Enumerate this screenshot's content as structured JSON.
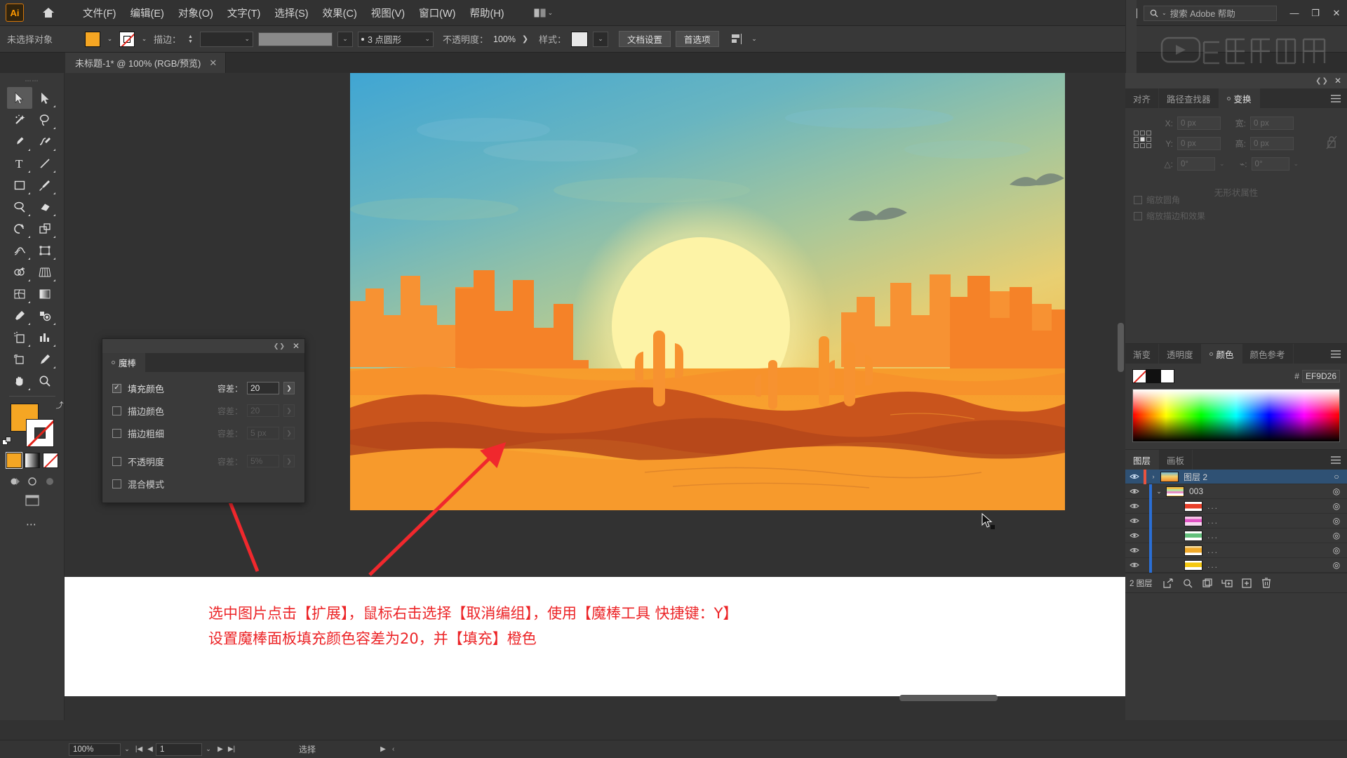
{
  "app": {
    "logo": "Ai",
    "home_icon": "home-icon"
  },
  "menubar": {
    "items": [
      {
        "label": "文件(F)"
      },
      {
        "label": "编辑(E)"
      },
      {
        "label": "对象(O)"
      },
      {
        "label": "文字(T)"
      },
      {
        "label": "选择(S)"
      },
      {
        "label": "效果(C)"
      },
      {
        "label": "视图(V)"
      },
      {
        "label": "窗口(W)"
      },
      {
        "label": "帮助(H)"
      }
    ],
    "arrange_label": "",
    "search_placeholder": "搜索 Adobe 帮助",
    "minimize": "—",
    "maximize": "❐",
    "close": "✕"
  },
  "optionsbar": {
    "no_selection_label": "未选择对象",
    "fill_color": "#F5A623",
    "stroke_label": "描边：",
    "stroke_weight_value": "",
    "profile_value": "",
    "brush_value": "3 点圆形",
    "opacity_label": "不透明度：",
    "opacity_value": "100%",
    "style_label": "样式：",
    "doc_setup_button": "文档设置",
    "preferences_button": "首选项",
    "align_icon": "align-icon"
  },
  "document_tab": {
    "title": "未标题-1* @ 100% (RGB/预览)",
    "close": "✕"
  },
  "toolbar": {
    "tools": [
      {
        "name": "selection-tool",
        "selected": true
      },
      {
        "name": "direct-selection-tool",
        "selected": false
      },
      {
        "name": "magic-wand-tool",
        "selected": false
      },
      {
        "name": "lasso-tool",
        "selected": false
      },
      {
        "name": "pen-tool",
        "selected": false
      },
      {
        "name": "curvature-tool",
        "selected": false
      },
      {
        "name": "type-tool",
        "selected": false
      },
      {
        "name": "line-segment-tool",
        "selected": false
      },
      {
        "name": "rectangle-tool",
        "selected": false
      },
      {
        "name": "paintbrush-tool",
        "selected": false
      },
      {
        "name": "shaper-tool",
        "selected": false
      },
      {
        "name": "eraser-tool",
        "selected": false
      },
      {
        "name": "rotate-tool",
        "selected": false
      },
      {
        "name": "scale-tool",
        "selected": false
      },
      {
        "name": "width-tool",
        "selected": false
      },
      {
        "name": "free-transform-tool",
        "selected": false
      },
      {
        "name": "shape-builder-tool",
        "selected": false
      },
      {
        "name": "perspective-grid-tool",
        "selected": false
      },
      {
        "name": "mesh-tool",
        "selected": false
      },
      {
        "name": "gradient-tool",
        "selected": false
      },
      {
        "name": "eyedropper-tool",
        "selected": false
      },
      {
        "name": "blend-tool",
        "selected": false
      },
      {
        "name": "symbol-sprayer-tool",
        "selected": false
      },
      {
        "name": "column-graph-tool",
        "selected": false
      },
      {
        "name": "artboard-tool",
        "selected": false
      },
      {
        "name": "slice-tool",
        "selected": false
      },
      {
        "name": "hand-tool",
        "selected": false
      },
      {
        "name": "zoom-tool",
        "selected": false
      }
    ],
    "fill_color": "#F5A623",
    "stroke_color": "none",
    "more_tools": "⋯"
  },
  "magic_wand_panel": {
    "tab_label": "魔棒",
    "close": "✕",
    "collapse": "▾",
    "rows": [
      {
        "label": "填充颜色",
        "checked": true,
        "tol_label": "容差：",
        "tol_value": "20",
        "enabled": true
      },
      {
        "label": "描边颜色",
        "checked": false,
        "tol_label": "容差：",
        "tol_value": "20",
        "enabled": false
      },
      {
        "label": "描边粗细",
        "checked": false,
        "tol_label": "容差：",
        "tol_value": "5 px",
        "enabled": false
      },
      {
        "label": "不透明度",
        "checked": false,
        "tol_label": "容差：",
        "tol_value": "5%",
        "enabled": false
      },
      {
        "label": "混合模式",
        "checked": false,
        "tol_label": "",
        "tol_value": "",
        "enabled": false
      }
    ]
  },
  "annotation": {
    "line1": "选中图片点击【扩展】，鼠标右击选择【取消编组】，使用【魔棒工具 快捷键：Y】",
    "line2": "设置魔棒面板填充颜色容差为20，并【填充】橙色",
    "color": "#EC2427"
  },
  "transform_panel": {
    "tabs": [
      {
        "label": "对齐",
        "active": false,
        "dot": false
      },
      {
        "label": "路径查找器",
        "active": false,
        "dot": false
      },
      {
        "label": "变换",
        "active": true,
        "dot": true
      }
    ],
    "menu_icon": "panel-menu-icon",
    "fields": [
      {
        "label": "X:",
        "value": "0 px"
      },
      {
        "label": "宽:",
        "value": "0 px"
      },
      {
        "label": "Y:",
        "value": "0 px"
      },
      {
        "label": "高:",
        "value": "0 px"
      }
    ],
    "angle_label": "△:",
    "angle_value": "0°",
    "shear_label": "⌁:",
    "shear_value": "0°",
    "lock_icon": "link-broken-icon",
    "no_properties": "无形状属性",
    "checkbox1": "缩放圆角",
    "checkbox2": "缩放描边和效果"
  },
  "color_panel": {
    "tabs": [
      {
        "label": "渐变",
        "active": false,
        "dot": false
      },
      {
        "label": "透明度",
        "active": false,
        "dot": false
      },
      {
        "label": "颜色",
        "active": true,
        "dot": true
      },
      {
        "label": "颜色参考",
        "active": false,
        "dot": false
      }
    ],
    "menu_icon": "panel-menu-icon",
    "hex_label": "#",
    "hex_value": "EF9D26",
    "swatch_none": "none-swatch",
    "swatch_black": "#000000",
    "swatch_white": "#FFFFFF"
  },
  "layers_panel": {
    "tabs": [
      {
        "label": "图层",
        "active": true
      },
      {
        "label": "画板",
        "active": false
      }
    ],
    "menu_icon": "panel-menu-icon",
    "rows": [
      {
        "name": "图层 2",
        "selected": true,
        "indent": 0,
        "color": "#e8533f",
        "arrow": "›",
        "thumb": "thumb-sunset",
        "eye": true,
        "target": "○"
      },
      {
        "name": "003",
        "selected": false,
        "indent": 1,
        "color": "#2a6fd6",
        "arrow": "⌄",
        "thumb": "thumb-stripes",
        "eye": true,
        "target": "◎"
      },
      {
        "name": "...",
        "selected": false,
        "indent": 2,
        "color": "#2a6fd6",
        "arrow": "",
        "thumb": "thumb-red",
        "eye": true,
        "target": "◎"
      },
      {
        "name": "...",
        "selected": false,
        "indent": 2,
        "color": "#2a6fd6",
        "arrow": "",
        "thumb": "thumb-magenta",
        "eye": true,
        "target": "◎"
      },
      {
        "name": "...",
        "selected": false,
        "indent": 2,
        "color": "#2a6fd6",
        "arrow": "",
        "thumb": "thumb-green",
        "eye": true,
        "target": "◎"
      },
      {
        "name": "...",
        "selected": false,
        "indent": 2,
        "color": "#2a6fd6",
        "arrow": "",
        "thumb": "thumb-orange",
        "eye": true,
        "target": "◎"
      },
      {
        "name": "...",
        "selected": false,
        "indent": 2,
        "color": "#2a6fd6",
        "arrow": "",
        "thumb": "thumb-yellow",
        "eye": true,
        "target": "◎"
      }
    ],
    "footer_count": "2 图层",
    "footer_icons": [
      "release-icon",
      "locate-icon",
      "collect-icon",
      "new-sublayer-icon",
      "new-layer-icon",
      "delete-icon"
    ]
  },
  "statusbar": {
    "zoom_value": "100%",
    "page_value": "1",
    "status_text": "选择",
    "first_icon": "|◀",
    "prev_icon": "◀",
    "next_icon": "▶",
    "last_icon": "▶|",
    "expand_icon": "▶",
    "collapse_icon": "‹"
  },
  "artwork": {
    "description": "desert-sunset-illustration",
    "sky_top": "#3aa0d0",
    "sky_mid": "#a8c8a0",
    "sun_color": "#fdf3a8",
    "sand_color": "#f59a2a",
    "rock_color": "#f07c2a",
    "dune_dark": "#c4541e"
  }
}
